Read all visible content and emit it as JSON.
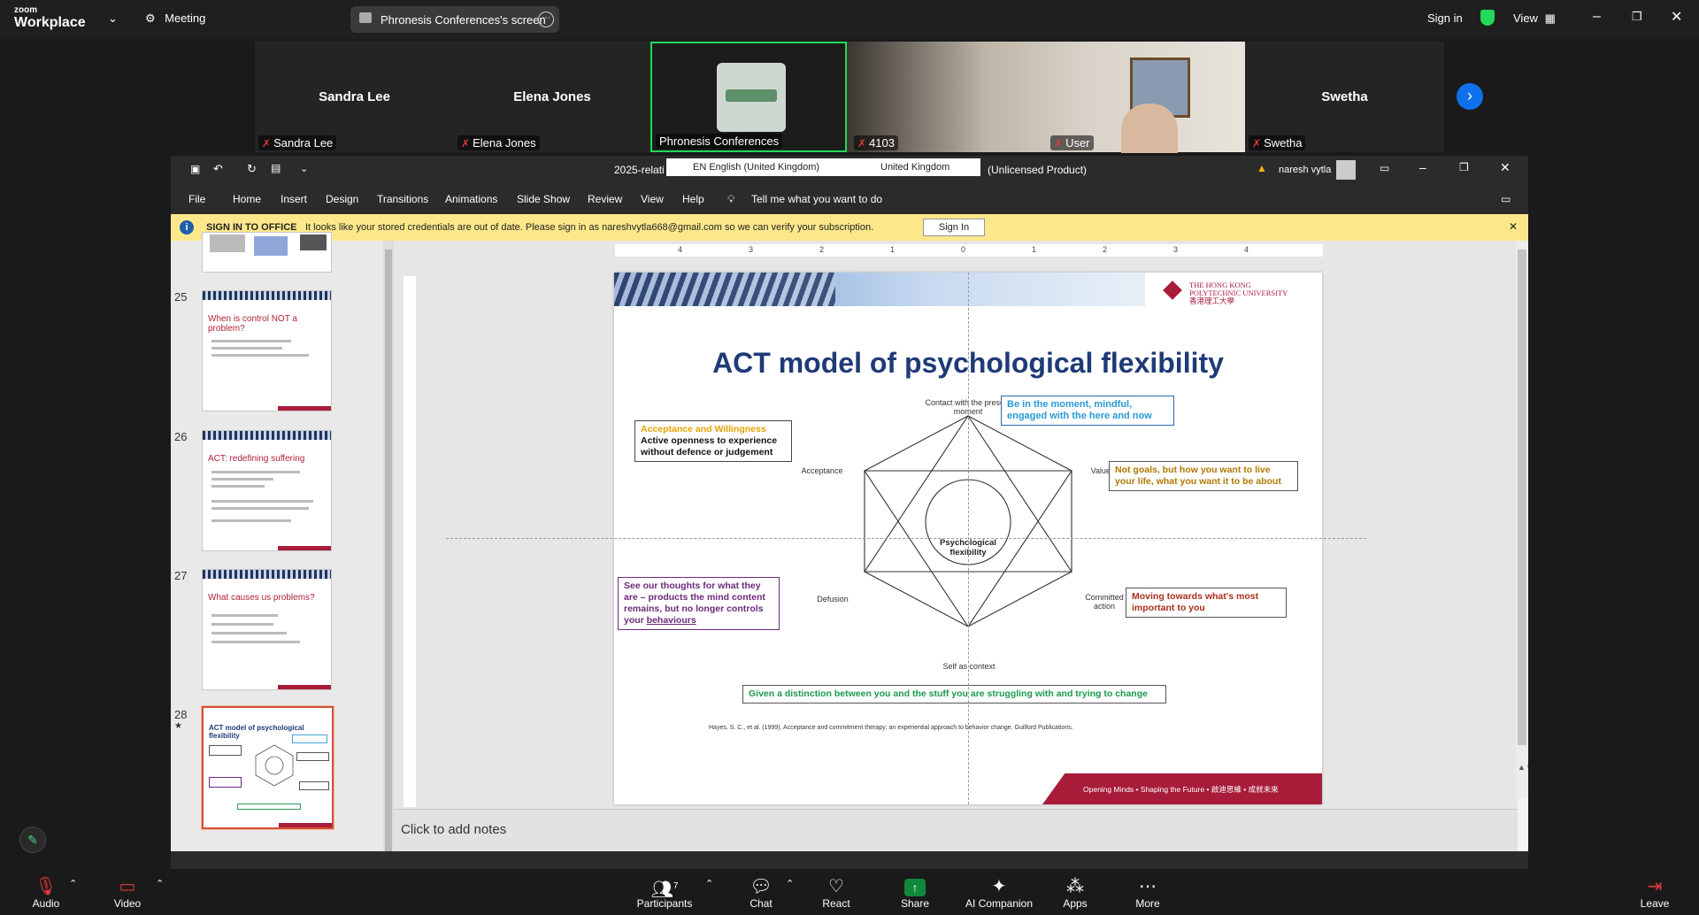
{
  "zoom_top": {
    "logo_line1": "zoom",
    "logo_line2": "Workplace",
    "meeting_label": "Meeting",
    "share_label": "Phronesis Conferences's screen",
    "signin_label": "Sign in",
    "view_label": "View"
  },
  "participants": [
    {
      "name": "Sandra Lee",
      "label": "Sandra Lee"
    },
    {
      "name": "Elena Jones",
      "label": "Elena Jones"
    },
    {
      "name": "",
      "label": "Phronesis Conferences"
    },
    {
      "name": "",
      "label": "4103"
    },
    {
      "name": "",
      "label": "User"
    },
    {
      "name": "Swetha",
      "label": "Swetha"
    }
  ],
  "ppt": {
    "title_left": "2025-relati",
    "lang_pill": "EN English (United Kingdom)",
    "region_pill": "United Kingdom",
    "title_right": "(Unlicensed Product)",
    "user": "naresh vytla",
    "menu": [
      "File",
      "Home",
      "Insert",
      "Design",
      "Transitions",
      "Animations",
      "Slide Show",
      "Review",
      "View",
      "Help"
    ],
    "tell_me": "Tell me what you want to do",
    "infobar": {
      "title": "SIGN IN TO OFFICE",
      "message": "It looks like your stored credentials are out of date. Please sign in as nareshvytla668@gmail.com so we can verify your subscription.",
      "button": "Sign In"
    },
    "thumbs": [
      {
        "num": "25",
        "title": "When is control NOT a problem?"
      },
      {
        "num": "26",
        "title": "ACT: redefining suffering"
      },
      {
        "num": "27",
        "title": "What causes us problems?"
      },
      {
        "num": "28",
        "title": "ACT model of psychological flexibility"
      }
    ],
    "ruler": [
      "4",
      "3",
      "2",
      "1",
      "0",
      "1",
      "2",
      "3",
      "4"
    ],
    "notes_placeholder": "Click to add notes"
  },
  "slide": {
    "university": "THE HONG KONG POLYTECHNIC UNIVERSITY",
    "university_cn": "香港理工大學",
    "title": "ACT model of psychological flexibility",
    "center": "Psychological flexibility",
    "vertices": {
      "top": "Contact with the present moment",
      "left_top": "Acceptance",
      "right_top": "Values",
      "left_bottom": "Defusion",
      "right_bottom": "Committed action",
      "bottom": "Self as context"
    },
    "boxes": {
      "acceptance_title": "Acceptance and Willingness",
      "acceptance_body": "Active openness to experience without defence or judgement",
      "present": "Be in the moment, mindful, engaged with the here and now",
      "values": "Not goals, but how you want to live your life, what you want it to be about",
      "defusion_pre": "See our thoughts for what they are – products the mind content remains, but no longer controls your ",
      "defusion_link": "behaviours",
      "committed": "Moving towards what's most important to you",
      "self": "Given a distinction between you and the stuff you are struggling with and trying to change"
    },
    "reference": "Hayes, S. C., et al. (1999). Acceptance and commitment therapy: an experiential approach to behavior change. Guilford Publications.",
    "footer": "Opening Minds • Shaping the Future • 啟迪思維 • 成就未來"
  },
  "zoom_bottom": {
    "audio": "Audio",
    "video": "Video",
    "participants": "Participants",
    "participants_count": "7",
    "chat": "Chat",
    "react": "React",
    "share": "Share",
    "ai": "AI Companion",
    "apps": "Apps",
    "more": "More",
    "leave": "Leave"
  },
  "colors": {
    "accent_green": "#23d959",
    "share_green": "#0e8a3a",
    "leave_red": "#e0383e",
    "slide_red": "#a81c3a",
    "slide_blue": "#1f3a78"
  }
}
